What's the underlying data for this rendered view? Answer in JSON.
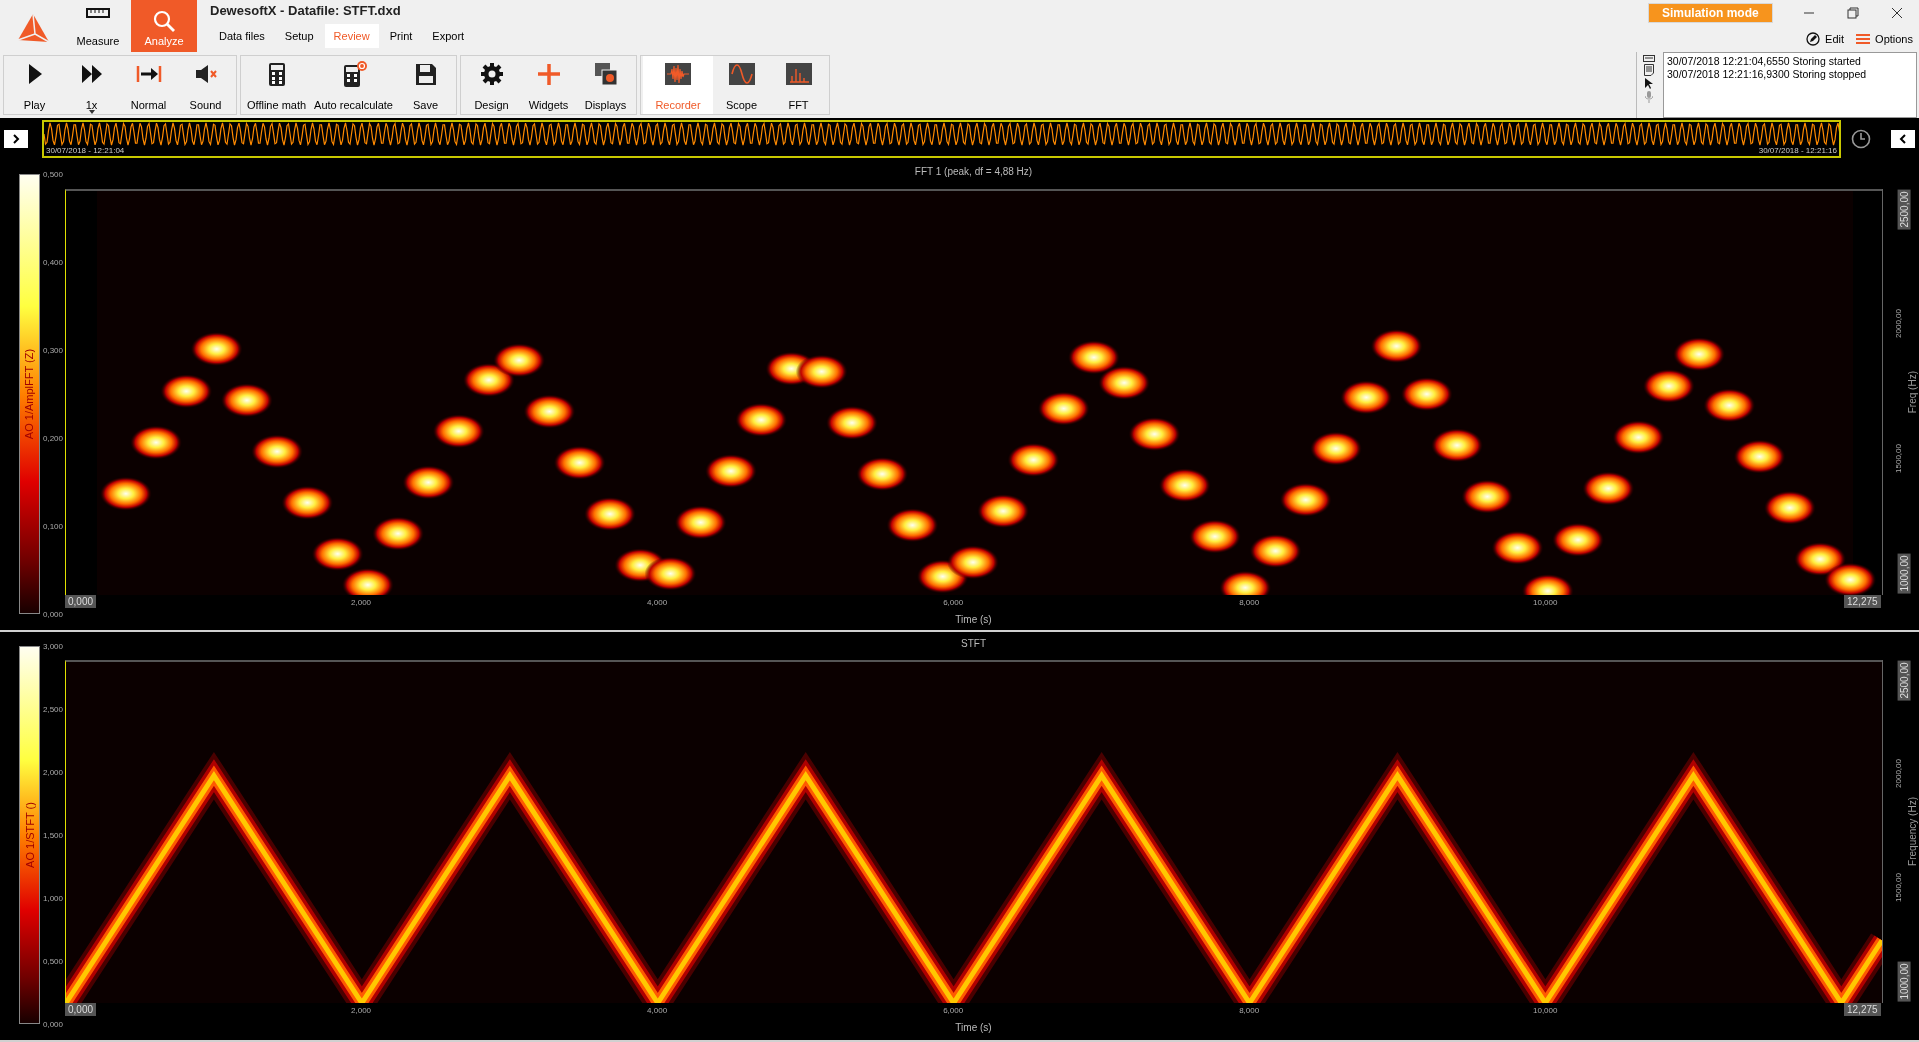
{
  "app": {
    "title": "DewesoftX - Datafile: STFT.dxd",
    "modes": [
      {
        "label": "Measure",
        "selected": false
      },
      {
        "label": "Analyze",
        "selected": true
      }
    ],
    "menu": [
      {
        "label": "Data files",
        "selected": false
      },
      {
        "label": "Setup",
        "selected": false
      },
      {
        "label": "Review",
        "selected": true
      },
      {
        "label": "Print",
        "selected": false
      },
      {
        "label": "Export",
        "selected": false
      }
    ],
    "badge": "Simulation mode",
    "actions": [
      "Edit",
      "Options"
    ]
  },
  "toolbar": {
    "groups": [
      {
        "buttons": [
          {
            "label": "Play",
            "kind": "button",
            "selected": false
          },
          {
            "label": "1x",
            "kind": "dropdown",
            "selected": false
          },
          {
            "label": "Normal",
            "kind": "button",
            "selected": false
          },
          {
            "label": "Sound",
            "kind": "button",
            "selected": false
          }
        ]
      },
      {
        "buttons": [
          {
            "label": "Offline math",
            "kind": "button",
            "selected": false
          },
          {
            "label": "Auto recalculate",
            "kind": "button",
            "selected": false
          },
          {
            "label": "Save",
            "kind": "button",
            "selected": false
          }
        ]
      },
      {
        "buttons": [
          {
            "label": "Design",
            "kind": "button",
            "selected": false
          },
          {
            "label": "Widgets",
            "kind": "button",
            "selected": false
          },
          {
            "label": "Displays",
            "kind": "button",
            "selected": false
          }
        ]
      },
      {
        "buttons": [
          {
            "label": "Recorder",
            "kind": "button",
            "selected": true
          },
          {
            "label": "Scope",
            "kind": "button",
            "selected": false
          },
          {
            "label": "FFT",
            "kind": "button",
            "selected": false
          }
        ]
      }
    ]
  },
  "event_log": {
    "entries": [
      "30/07/2018 12:21:04,6550 Storing started",
      "30/07/2018 12:21:16,9300 Storing stopped"
    ]
  },
  "timeline": {
    "start_time": "30/07/2018 - 12:21:04",
    "end_time": "30/07/2018 - 12:21:16"
  },
  "charts": [
    {
      "title": "FFT 1 (peak, df = 4,88 Hz)",
      "kind": "peaks",
      "z_label": "AO 1/AmplFFT (Z)",
      "z_ticks": [
        "0,500",
        "0,400",
        "0,300",
        "0,200",
        "0,100",
        "0,000"
      ],
      "y_ticks": [
        "2500,00",
        "2000,00",
        "1500,00",
        "1000,00"
      ],
      "y_label": "Freq (Hz)",
      "x_start": "0,000",
      "x_ticks": [
        "2,000",
        "4,000",
        "6,000",
        "8,000",
        "10,000"
      ],
      "x_end": "12,275",
      "x_label": "Time (s)"
    },
    {
      "title": "STFT",
      "kind": "trace",
      "z_label": "AO 1/STFT ()",
      "z_ticks": [
        "3,000",
        "2,500",
        "2,000",
        "1,500",
        "1,000",
        "0,500",
        "0,000"
      ],
      "y_ticks": [
        "2500,00",
        "2000,00",
        "1500,00",
        "1000,00"
      ],
      "y_label": "Frequency (Hz)",
      "x_start": "0,000",
      "x_ticks": [
        "2,000",
        "4,000",
        "6,000",
        "8,000",
        "10,000"
      ],
      "x_end": "12,275",
      "x_label": "Time (s)"
    }
  ]
}
